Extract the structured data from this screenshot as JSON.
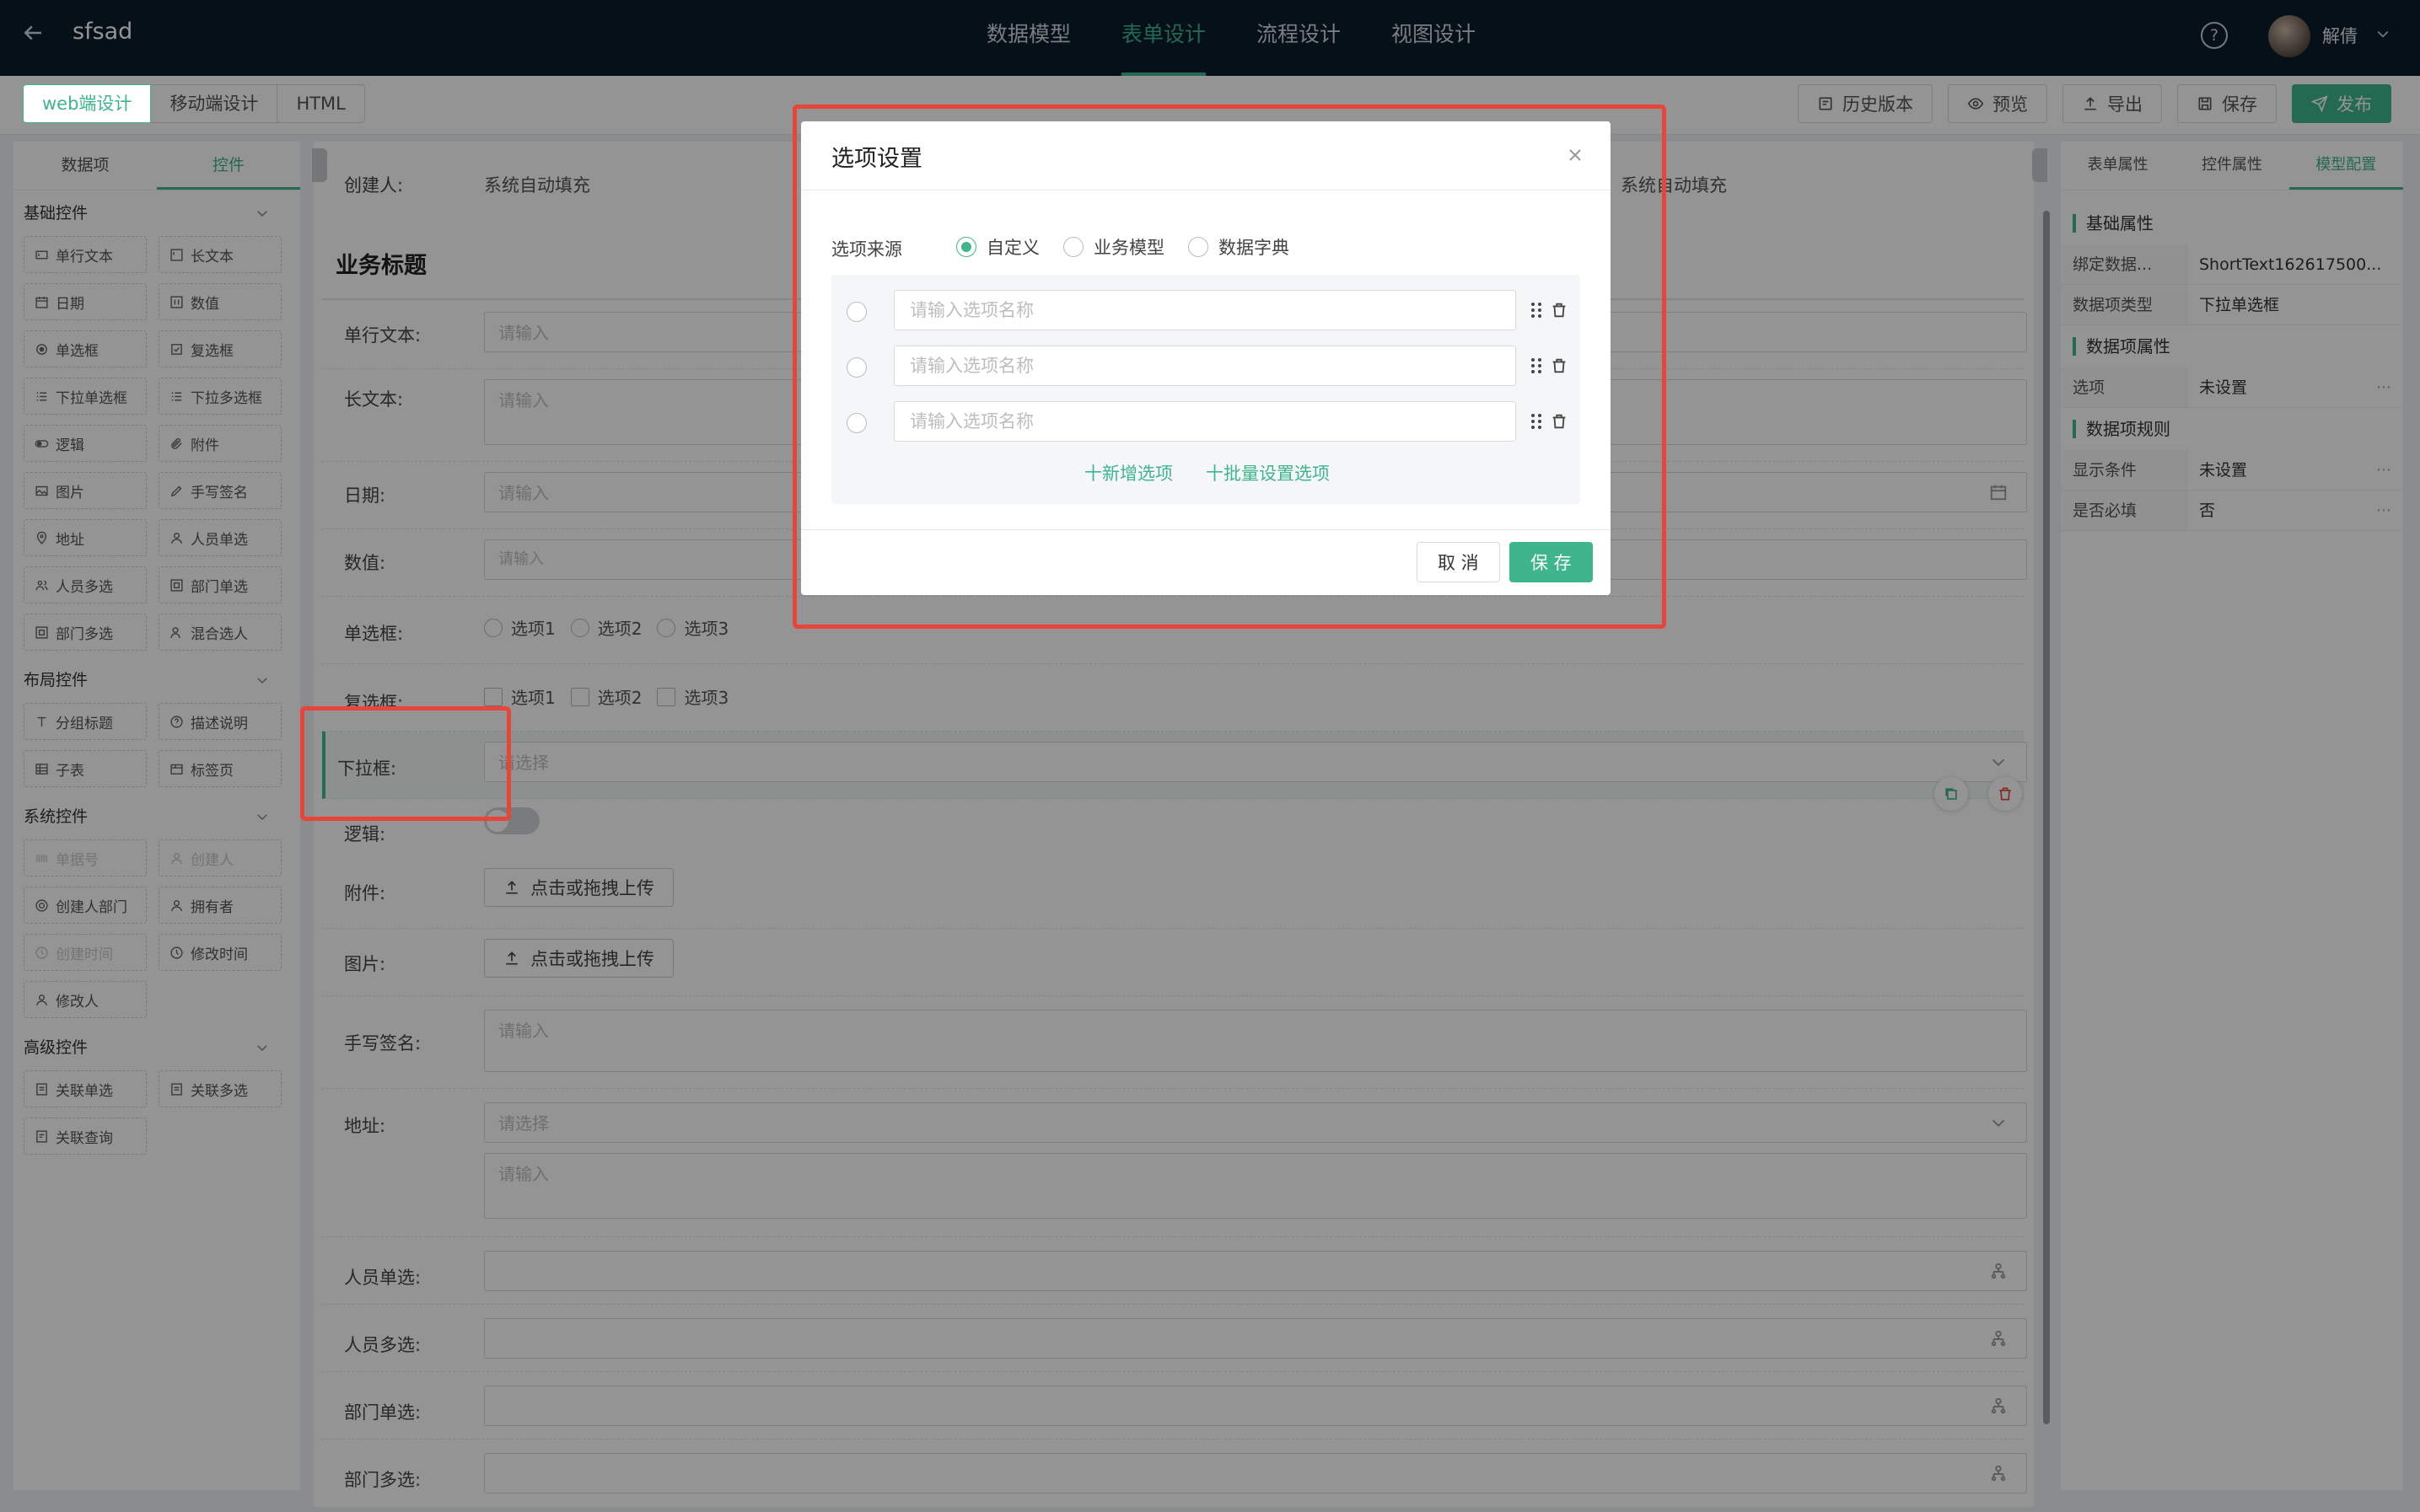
{
  "app": {
    "title": "sfsad",
    "user": "解倩",
    "help_icon": "?"
  },
  "topnav": [
    "数据模型",
    "表单设计",
    "流程设计",
    "视图设计"
  ],
  "design_modes": [
    "web端设计",
    "移动端设计",
    "HTML"
  ],
  "toolbar": {
    "history": "历史版本",
    "preview": "预览",
    "export": "导出",
    "save": "保存",
    "publish": "发布"
  },
  "left": {
    "tabs": [
      "数据项",
      "控件"
    ],
    "groups": {
      "basic": {
        "title": "基础控件",
        "items": [
          "单行文本",
          "长文本",
          "日期",
          "数值",
          "单选框",
          "复选框",
          "下拉单选框",
          "下拉多选框",
          "逻辑",
          "附件",
          "图片",
          "手写签名",
          "地址",
          "人员单选",
          "人员多选",
          "部门单选",
          "部门多选",
          "混合选人"
        ]
      },
      "layout": {
        "title": "布局控件",
        "items": [
          "分组标题",
          "描述说明",
          "子表",
          "标签页"
        ]
      },
      "system": {
        "title": "系统控件",
        "items": [
          "单据号",
          "创建人",
          "创建人部门",
          "拥有者",
          "创建时间",
          "修改时间",
          "修改人"
        ]
      },
      "advanced": {
        "title": "高级控件",
        "items": [
          "关联单选",
          "关联多选",
          "关联查询"
        ]
      }
    }
  },
  "form": {
    "creator_label": "创建人:",
    "auto_fill": "系统自动填充",
    "section_title": "业务标题",
    "fields": {
      "single": {
        "label": "单行文本:",
        "placeholder": "请输入"
      },
      "long": {
        "label": "长文本:",
        "placeholder": "请输入"
      },
      "date": {
        "label": "日期:",
        "placeholder": "请输入"
      },
      "number": {
        "label": "数值:",
        "placeholder": "请输入"
      },
      "radio": {
        "label": "单选框:",
        "options": [
          "选项1",
          "选项2",
          "选项3"
        ]
      },
      "checkbox": {
        "label": "复选框:",
        "options": [
          "选项1",
          "选项2",
          "选项3"
        ]
      },
      "dropdown": {
        "label": "下拉框:",
        "placeholder": "请选择"
      },
      "logic": {
        "label": "逻辑:"
      },
      "attachment": {
        "label": "附件:",
        "button": "点击或拖拽上传"
      },
      "image": {
        "label": "图片:",
        "button": "点击或拖拽上传"
      },
      "signature": {
        "label": "手写签名:",
        "placeholder": "请输入"
      },
      "address": {
        "label": "地址:",
        "select_placeholder": "请选择",
        "detail_placeholder": "请输入"
      },
      "person_single": {
        "label": "人员单选:"
      },
      "person_multi": {
        "label": "人员多选:"
      },
      "dept_single": {
        "label": "部门单选:"
      },
      "dept_multi": {
        "label": "部门多选:"
      }
    }
  },
  "right": {
    "tabs": [
      "表单属性",
      "控件属性",
      "模型配置"
    ],
    "sections": {
      "basic": {
        "title": "基础属性",
        "rows": [
          {
            "k": "绑定数据...",
            "v": "ShortText162617500..."
          },
          {
            "k": "数据项类型",
            "v": "下拉单选框"
          }
        ]
      },
      "data": {
        "title": "数据项属性",
        "rows": [
          {
            "k": "选项",
            "v": "未设置",
            "more": "···"
          }
        ]
      },
      "rules": {
        "title": "数据项规则",
        "rows": [
          {
            "k": "显示条件",
            "v": "未设置",
            "more": "···"
          },
          {
            "k": "是否必填",
            "v": "否",
            "more": "···"
          }
        ]
      }
    }
  },
  "modal": {
    "title": "选项设置",
    "source_label": "选项来源",
    "sources": [
      "自定义",
      "业务模型",
      "数据字典"
    ],
    "selected_source": "自定义",
    "option_placeholder": "请输入选项名称",
    "add_option": "十新增选项",
    "batch_set": "十批量设置选项",
    "cancel": "取 消",
    "save": "保 存"
  },
  "colors": {
    "accent": "#3fb58e",
    "topbar": "#0c1c2b",
    "annotation": "#e8443a"
  }
}
